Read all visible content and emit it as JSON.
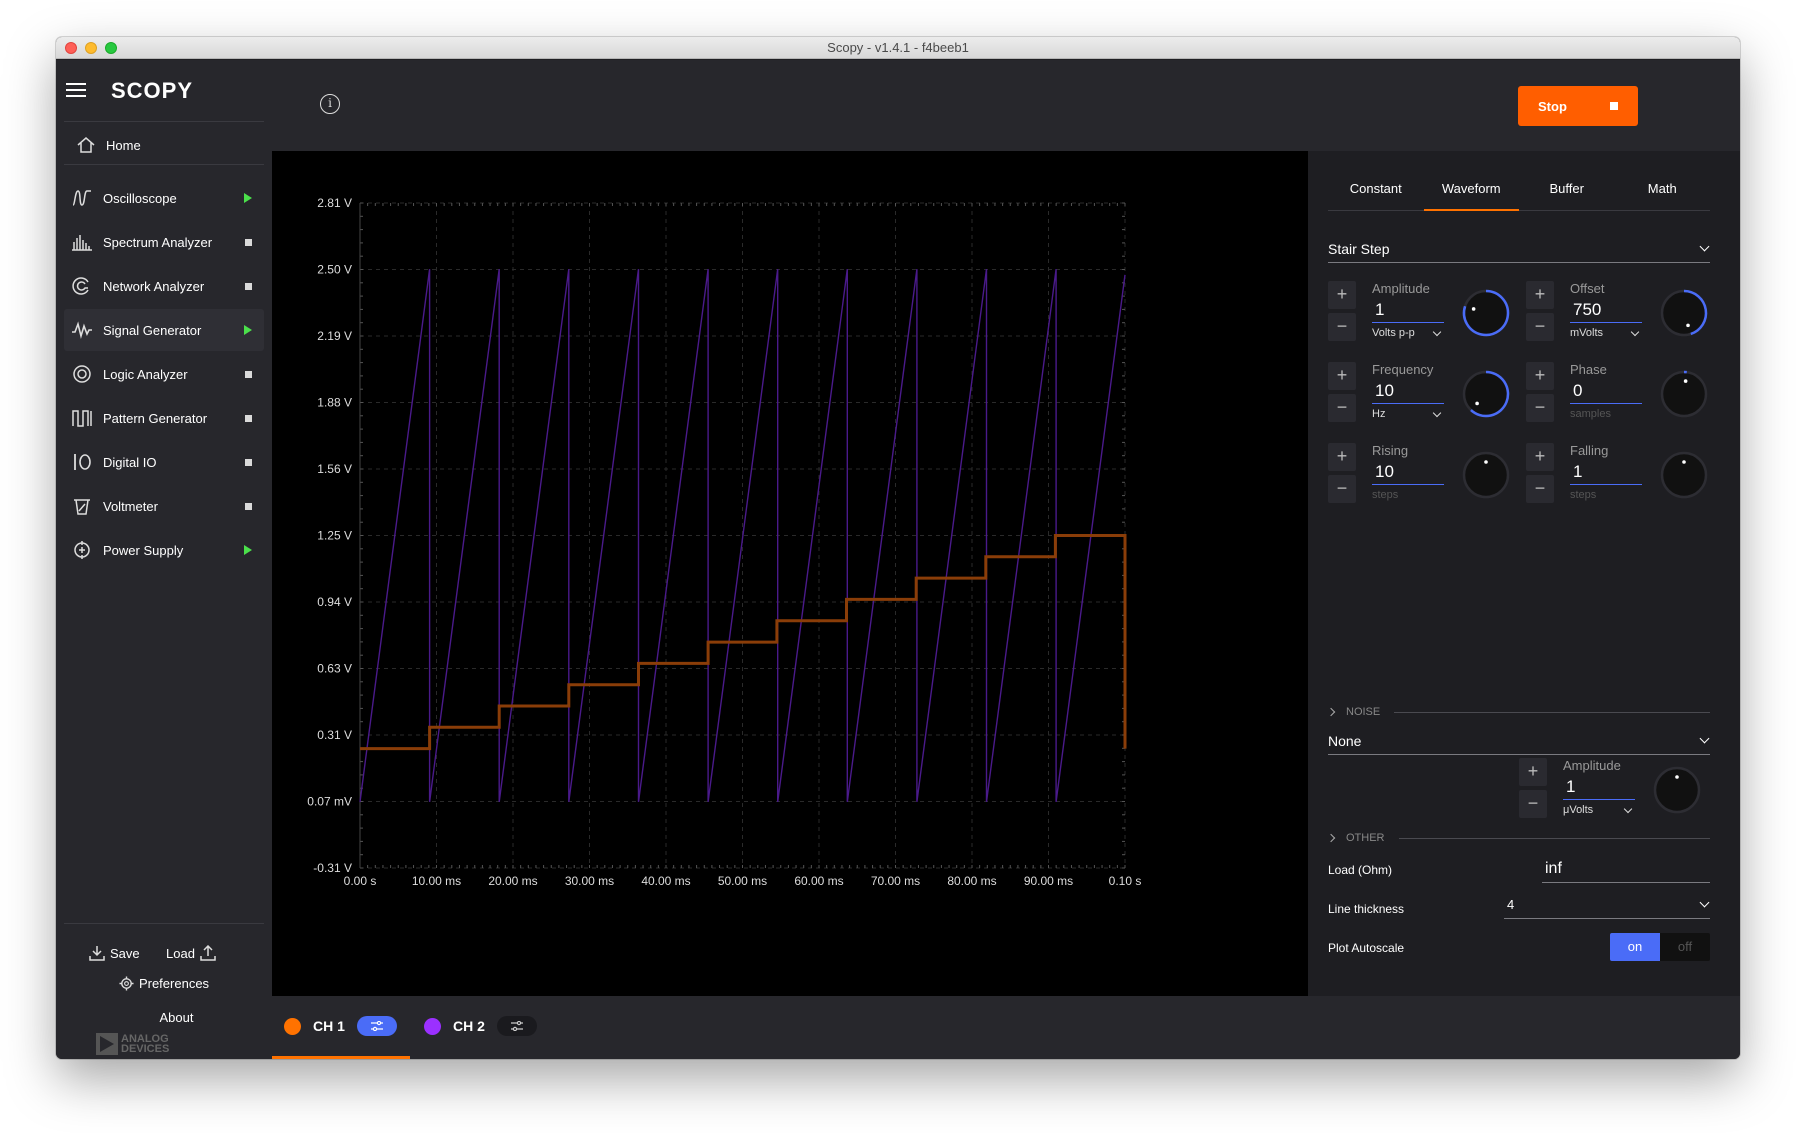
{
  "window": {
    "title": "Scopy - v1.4.1 - f4beeb1"
  },
  "sidebar": {
    "logo": "SCOPY",
    "home": "Home",
    "items": [
      {
        "label": "Oscilloscope",
        "state": "running",
        "icon": "oscilloscope-icon"
      },
      {
        "label": "Spectrum Analyzer",
        "state": "stopped",
        "icon": "spectrum-icon"
      },
      {
        "label": "Network Analyzer",
        "state": "stopped",
        "icon": "network-icon"
      },
      {
        "label": "Signal Generator",
        "state": "running",
        "icon": "signal-icon",
        "active": true
      },
      {
        "label": "Logic Analyzer",
        "state": "stopped",
        "icon": "logic-icon"
      },
      {
        "label": "Pattern Generator",
        "state": "stopped",
        "icon": "pattern-icon"
      },
      {
        "label": "Digital IO",
        "state": "stopped",
        "icon": "digital-io-icon"
      },
      {
        "label": "Voltmeter",
        "state": "stopped",
        "icon": "voltmeter-icon"
      },
      {
        "label": "Power Supply",
        "state": "running",
        "icon": "power-icon"
      }
    ],
    "save": "Save",
    "load": "Load",
    "preferences": "Preferences",
    "about": "About",
    "brand": "ANALOG DEVICES"
  },
  "toolbar": {
    "stop_label": "Stop"
  },
  "chart_data": {
    "type": "line",
    "yticks": [
      "2.81 V",
      "2.50 V",
      "2.19 V",
      "1.88 V",
      "1.56 V",
      "1.25 V",
      "0.94 V",
      "0.63 V",
      "0.31 V",
      "0.07 mV",
      "-0.31 V"
    ],
    "xticks": [
      "0.00 s",
      "10.00 ms",
      "20.00 ms",
      "30.00 ms",
      "40.00 ms",
      "50.00 ms",
      "60.00 ms",
      "70.00 ms",
      "80.00 ms",
      "90.00 ms",
      "0.10 s"
    ],
    "xlim": [
      0,
      0.1
    ],
    "ylim": [
      -0.31,
      2.81
    ],
    "grid": true,
    "series": [
      {
        "name": "CH 1",
        "color": "#ff7200",
        "kind": "stair",
        "x": [
          0,
          0.0091,
          0.0182,
          0.0273,
          0.0364,
          0.0455,
          0.0545,
          0.0636,
          0.0727,
          0.0818,
          0.0909,
          0.1
        ],
        "y": [
          0.25,
          0.35,
          0.45,
          0.55,
          0.65,
          0.75,
          0.85,
          0.95,
          1.05,
          1.15,
          1.25,
          0.25
        ]
      },
      {
        "name": "CH 2",
        "color": "#8a2be2",
        "kind": "sawtooth",
        "period": 0.0091,
        "min": 0.0,
        "max": 2.5
      }
    ]
  },
  "panel": {
    "tabs": [
      "Constant",
      "Waveform",
      "Buffer",
      "Math"
    ],
    "active_tab": "Waveform",
    "waveform_type": "Stair Step",
    "amplitude": {
      "label": "Amplitude",
      "value": "1",
      "unit": "Volts p-p"
    },
    "offset": {
      "label": "Offset",
      "value": "750",
      "unit": "mVolts"
    },
    "frequency": {
      "label": "Frequency",
      "value": "10",
      "unit": "Hz"
    },
    "phase": {
      "label": "Phase",
      "value": "0",
      "unit": "samples"
    },
    "rising": {
      "label": "Rising",
      "value": "10",
      "unit": "steps"
    },
    "falling": {
      "label": "Falling",
      "value": "1",
      "unit": "steps"
    },
    "noise_header": "NOISE",
    "noise_type": "None",
    "noise_amplitude": {
      "label": "Amplitude",
      "value": "1",
      "unit": "μVolts"
    },
    "other_header": "OTHER",
    "load_label": "Load (Ohm)",
    "load_value": "inf",
    "line_thickness_label": "Line thickness",
    "line_thickness_value": "4",
    "plot_autoscale_label": "Plot Autoscale",
    "toggle_on": "on",
    "toggle_off": "off"
  },
  "channels": [
    {
      "label": "CH 1",
      "color": "#ff7200"
    },
    {
      "label": "CH 2",
      "color": "#9b30ff"
    }
  ],
  "colors": {
    "accent": "#ff7200",
    "stop": "#ff5e00",
    "blue": "#4a6cf7",
    "running": "#4be04b"
  }
}
